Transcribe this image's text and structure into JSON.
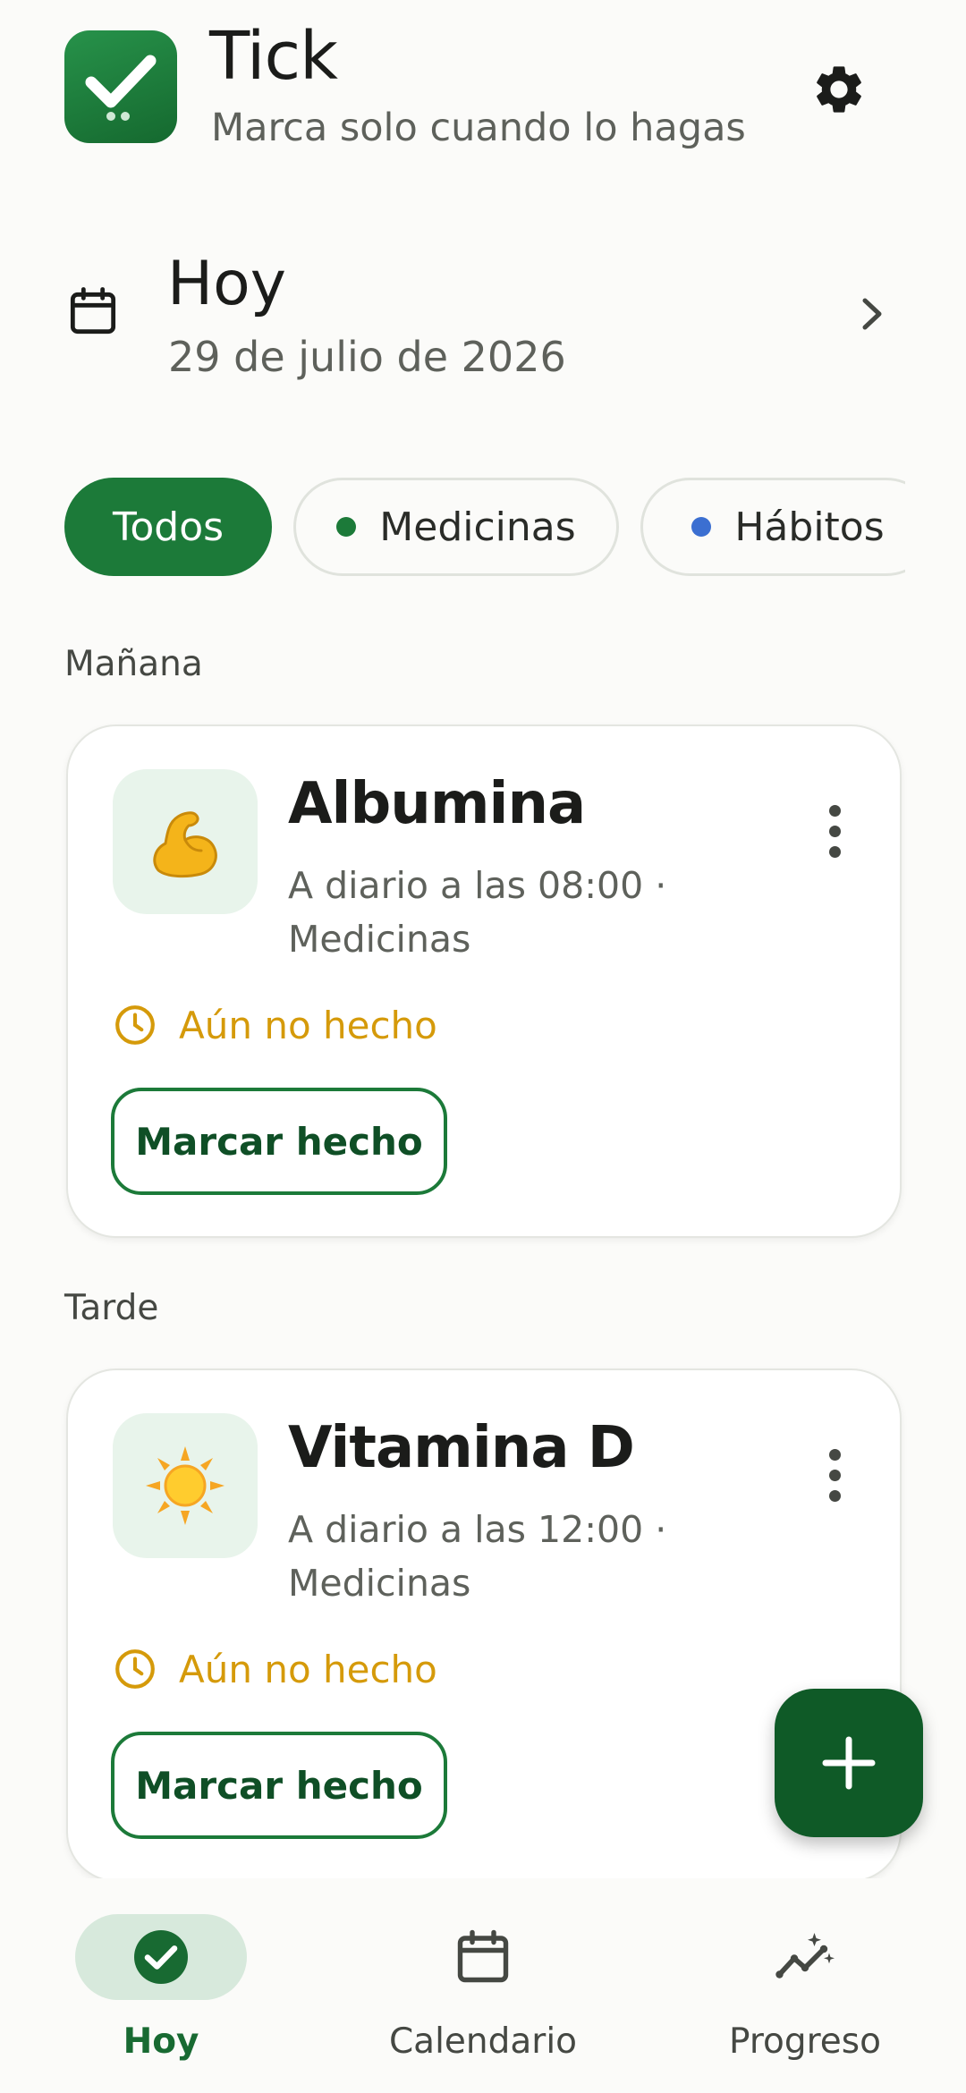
{
  "header": {
    "app_name": "Tick",
    "tagline": "Marca solo cuando lo hagas",
    "settings_icon": "gear-icon"
  },
  "date_nav": {
    "title": "Hoy",
    "date": "29 de julio de 2026",
    "icon": "calendar-icon",
    "next_icon": "chevron-right-icon"
  },
  "filters": [
    {
      "label": "Todos",
      "active": true
    },
    {
      "label": "Medicinas",
      "dot_color": "#1c7a39",
      "active": false
    },
    {
      "label": "Hábitos",
      "dot_color": "#3b6fd1",
      "active": false
    }
  ],
  "sections": [
    {
      "label": "Mañana",
      "items": [
        {
          "emoji": "💪",
          "name": "Albumina",
          "schedule": "A diario a las 08:00 · Medicinas",
          "status": "Aún no hecho",
          "action": "Marcar hecho"
        }
      ]
    },
    {
      "label": "Tarde",
      "items": [
        {
          "emoji": "☀️",
          "name": "Vitamina D",
          "schedule": "A diario a las 12:00 · Medicinas",
          "status": "Aún no hecho",
          "action": "Marcar hecho"
        }
      ]
    }
  ],
  "fab": {
    "icon": "plus-icon"
  },
  "bottom_nav": [
    {
      "label": "Hoy",
      "icon": "check-circle-icon",
      "active": true
    },
    {
      "label": "Calendario",
      "icon": "calendar-icon",
      "active": false
    },
    {
      "label": "Progreso",
      "icon": "progress-sparkle-icon",
      "active": false
    }
  ],
  "colors": {
    "primary": "#1c7a39",
    "primary_dark": "#0f5a27",
    "pending": "#d59a0a",
    "background": "#fbfbf9"
  }
}
